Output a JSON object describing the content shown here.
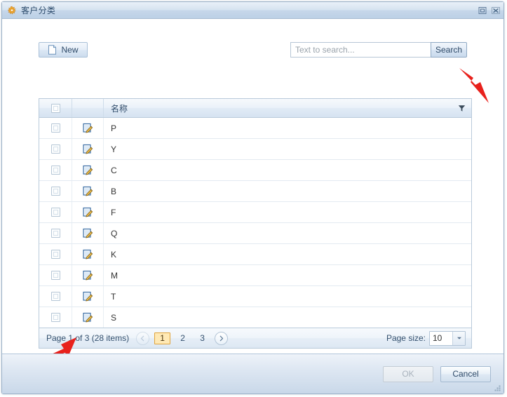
{
  "window": {
    "title": "客户分类",
    "title_icon": "gear-icon",
    "maximize_label": "Maximize",
    "close_label": "Close"
  },
  "toolbar": {
    "new_label": "New",
    "new_icon": "new-page-icon"
  },
  "search": {
    "placeholder": "Text to search...",
    "value": "",
    "button_label": "Search"
  },
  "grid": {
    "columns": [
      {
        "key": "select",
        "label": ""
      },
      {
        "key": "edit",
        "label": ""
      },
      {
        "key": "name",
        "label": "名称"
      }
    ],
    "filter_icon": "filter-icon",
    "select_all_checked": false,
    "rows": [
      {
        "name": "P",
        "checked": false
      },
      {
        "name": "Y",
        "checked": false
      },
      {
        "name": "C",
        "checked": false
      },
      {
        "name": "B",
        "checked": false
      },
      {
        "name": "F",
        "checked": false
      },
      {
        "name": "Q",
        "checked": false
      },
      {
        "name": "K",
        "checked": false
      },
      {
        "name": "M",
        "checked": false
      },
      {
        "name": "T",
        "checked": false
      },
      {
        "name": "S",
        "checked": false
      }
    ]
  },
  "pager": {
    "info": "Page 1 of 3 (28 items)",
    "current_page": 1,
    "total_pages": 3,
    "total_items": 28,
    "pages": [
      "1",
      "2",
      "3"
    ],
    "prev_label": "‹",
    "next_label": "›",
    "page_size_label": "Page size:",
    "page_size_value": "10"
  },
  "footer": {
    "ok_label": "OK",
    "ok_disabled": true,
    "cancel_label": "Cancel"
  },
  "annotations": {
    "arrow_color": "#e8211c",
    "arrow_search_target": "Search button",
    "arrow_pager_target": "Page 1 of 3 (28 items)"
  },
  "colors": {
    "title_bar": "#cadced",
    "accent_page_active": "#ffe9b5",
    "grid_border": "#b9cadb",
    "annotation_red": "#e8211c"
  }
}
